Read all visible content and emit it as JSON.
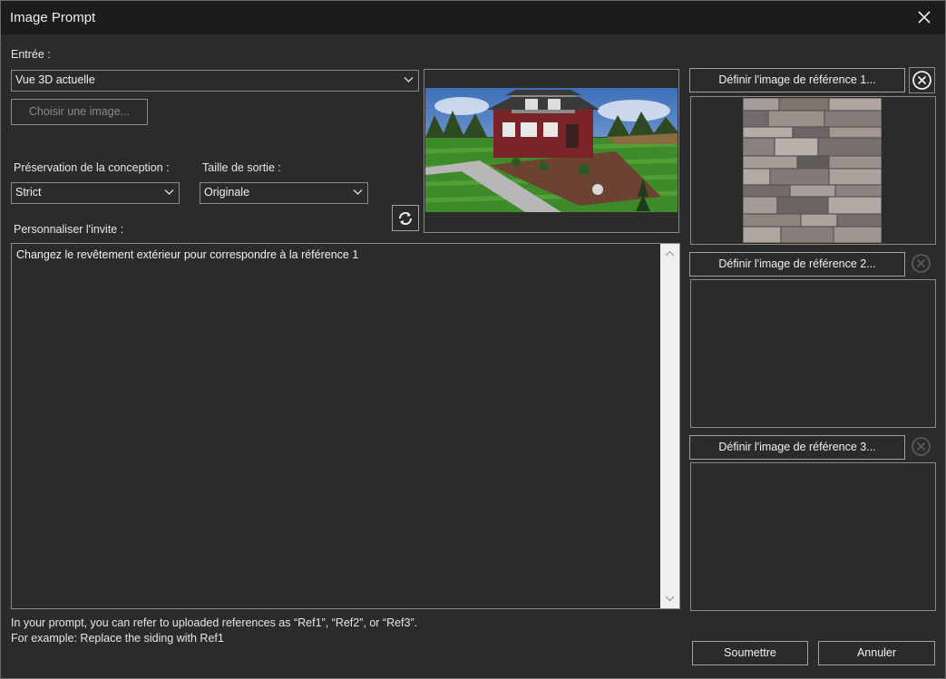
{
  "window": {
    "title": "Image Prompt"
  },
  "input": {
    "label": "Entrée :",
    "source_value": "Vue 3D actuelle",
    "choose_image_button": "Choisir une image..."
  },
  "preservation": {
    "label": "Préservation de la conception :",
    "value": "Strict"
  },
  "output_size": {
    "label": "Taille de sortie :",
    "value": "Originale"
  },
  "prompt": {
    "label": "Personnaliser l'invite :",
    "text": "Changez le revêtement extérieur pour correspondre à la référence 1"
  },
  "references": [
    {
      "button": "Définir l'image de référence 1...",
      "has_image": true
    },
    {
      "button": "Définir l'image de référence 2...",
      "has_image": false
    },
    {
      "button": "Définir l'image de référence 3...",
      "has_image": false
    }
  ],
  "hint": {
    "line1": "In your prompt, you can refer to uploaded references as “Ref1”, “Ref2”, or “Ref3”.",
    "line2": "For example: Replace the siding with Ref1"
  },
  "actions": {
    "submit": "Soumettre",
    "cancel": "Annuler"
  },
  "colors": {
    "background": "#2b2b2b",
    "titlebar": "#1c1c1c",
    "border": "#8a8a8a",
    "text": "#e6e6e6"
  },
  "icons": {
    "close": "close-icon",
    "refresh": "refresh-icon",
    "clear": "clear-circle-x-icon",
    "chevron": "chevron-down-icon"
  }
}
